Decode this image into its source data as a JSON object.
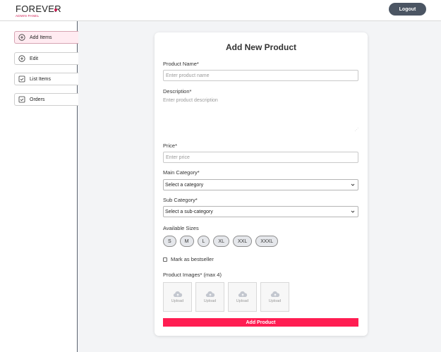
{
  "header": {
    "logo_text": "FOREVER",
    "logo_sub": "ADMIN PANEL",
    "logout_label": "Logout"
  },
  "sidebar": {
    "items": [
      {
        "label": "Add Items",
        "icon": "plus-circle-icon"
      },
      {
        "label": "Edit",
        "icon": "plus-circle-icon"
      },
      {
        "label": "List Items",
        "icon": "checkbox-icon"
      },
      {
        "label": "Orders",
        "icon": "checkbox-icon"
      }
    ]
  },
  "form": {
    "title": "Add New Product",
    "name_label": "Product Name*",
    "name_placeholder": "Enter product name",
    "description_label": "Description*",
    "description_placeholder": "Enter product description",
    "price_label": "Price*",
    "price_placeholder": "Enter price",
    "main_category_label": "Main Category*",
    "main_category_value": "Select a category",
    "sub_category_label": "Sub Category*",
    "sub_category_value": "Select a sub-category",
    "sizes_label": "Available Sizes",
    "sizes": [
      "S",
      "M",
      "L",
      "XL",
      "XXL",
      "XXXL"
    ],
    "bestseller_label": "Mark as bestseller",
    "images_label": "Product Images* (max 4)",
    "upload_label": "Upload",
    "submit_label": "Add Product"
  },
  "colors": {
    "accent": "#ff1d52",
    "logout_bg": "#4b5563",
    "active_item_bg": "#ffebf1"
  }
}
